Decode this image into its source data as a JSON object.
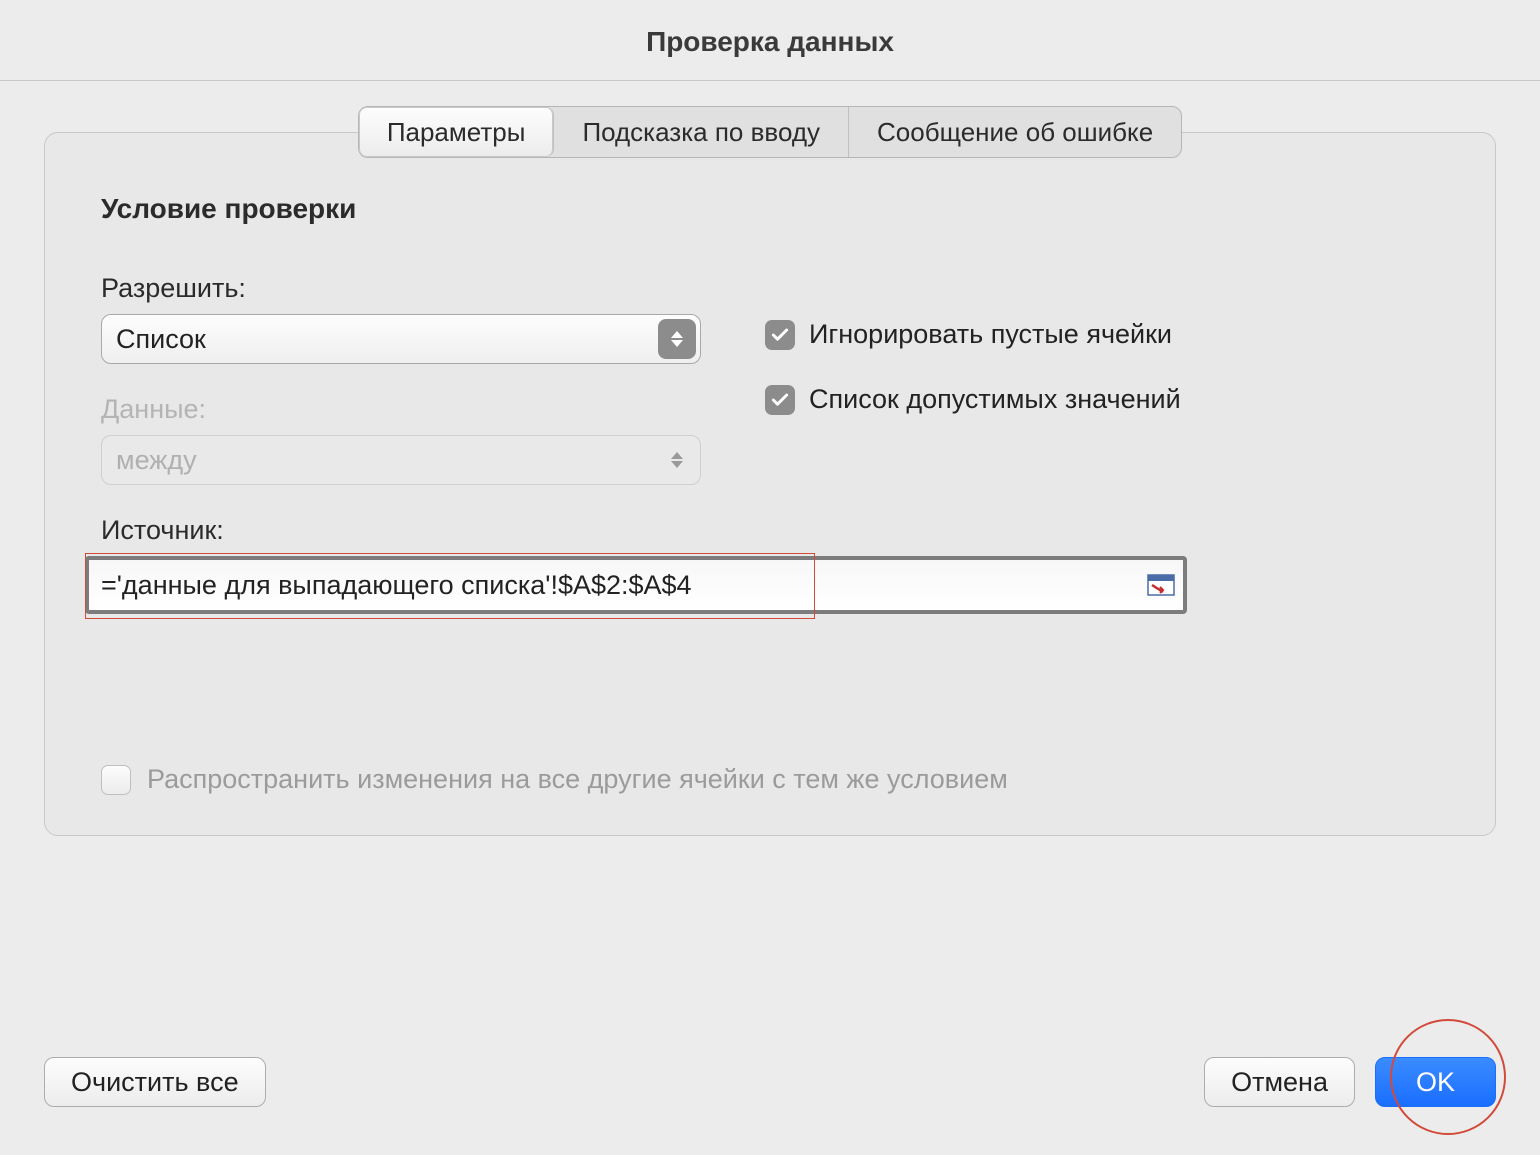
{
  "window": {
    "title": "Проверка данных"
  },
  "tabs": {
    "parameters": "Параметры",
    "input_hint": "Подсказка по вводу",
    "error_message": "Сообщение об ошибке"
  },
  "section": {
    "title": "Условие проверки"
  },
  "labels": {
    "allow": "Разрешить:",
    "data": "Данные:",
    "source": "Источник:"
  },
  "allow_select": {
    "value": "Список"
  },
  "data_select": {
    "value": "между"
  },
  "checks": {
    "ignore_blank": "Игнорировать пустые ячейки",
    "list_values": "Список допустимых значений"
  },
  "source": {
    "value": "='данные для выпадающего списка'!$A$2:$A$4"
  },
  "propagate": {
    "label": "Распространить изменения на все другие ячейки с тем же условием"
  },
  "buttons": {
    "clear_all": "Очистить все",
    "cancel": "Отмена",
    "ok": "OK"
  }
}
